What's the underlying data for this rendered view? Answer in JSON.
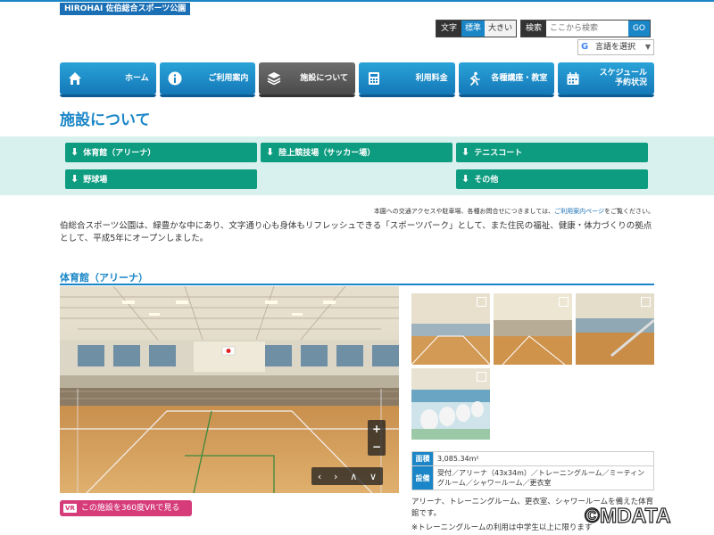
{
  "site": {
    "badge": "HIROHAI 佐伯総合スポーツ公園"
  },
  "font_size": {
    "label": "文字",
    "options": [
      "標準",
      "大きい"
    ],
    "selected": "標準"
  },
  "search": {
    "label": "検索",
    "placeholder": "ここから検索",
    "button": "GO"
  },
  "translate": {
    "label": "言語を選択",
    "caret": "▼"
  },
  "nav": {
    "items": [
      {
        "label": "ホーム",
        "icon": "home-icon"
      },
      {
        "label": "ご利用案内",
        "icon": "info-icon"
      },
      {
        "label": "施設について",
        "icon": "layers-icon",
        "active": true
      },
      {
        "label": "利用料金",
        "icon": "calculator-icon"
      },
      {
        "label": "各種講座・教室",
        "icon": "runner-icon"
      },
      {
        "label": "スケジュール\n予約状況",
        "icon": "calendar-icon"
      }
    ]
  },
  "page": {
    "title": "施設について"
  },
  "subnav": {
    "items": [
      {
        "label": "体育館（アリーナ）"
      },
      {
        "label": "陸上競技場（サッカー場）"
      },
      {
        "label": "テニスコート"
      },
      {
        "label": "野球場"
      },
      {
        "label": "その他"
      }
    ],
    "arrow": "⬇"
  },
  "note": {
    "before": "本園への交通アクセスや駐車場、各種お問合せにつきましては、",
    "link": "ご利用案内ページ",
    "after": "をご覧ください。"
  },
  "intro": "伯総合スポーツ公園は、緑豊かな中にあり、文字通り心も身体もリフレッシュできる「スポーツパーク」として、また住民の福祉、健康・体力づくりの拠点として、平成5年にオープンしました。",
  "section": {
    "title": "体育館（アリーナ）",
    "zoom_in": "+",
    "zoom_out": "−",
    "arrows": [
      "‹",
      "›",
      "∧",
      "∨"
    ],
    "vr_badge": "VR",
    "vr_label": "この施設を360度VRで見る",
    "table": [
      {
        "head": "面積",
        "value": "3,085.34m²"
      },
      {
        "head": "設備",
        "value": "受付／アリーナ（43x34m）／トレーニングルーム／ミーティングルーム／シャワールーム／更衣室"
      }
    ],
    "desc": "アリーナ、トレーニングルーム、更衣室、シャワールームを備えた体育館です。",
    "desc2": "※トレーニングルームの利用は中学生以上に限ります"
  },
  "watermark": "©MDATA",
  "colors": {
    "accent": "#1a86c7",
    "subnav": "#0e9c80",
    "subnav_band": "#d9f1ee",
    "vr": "#d63b7a"
  }
}
